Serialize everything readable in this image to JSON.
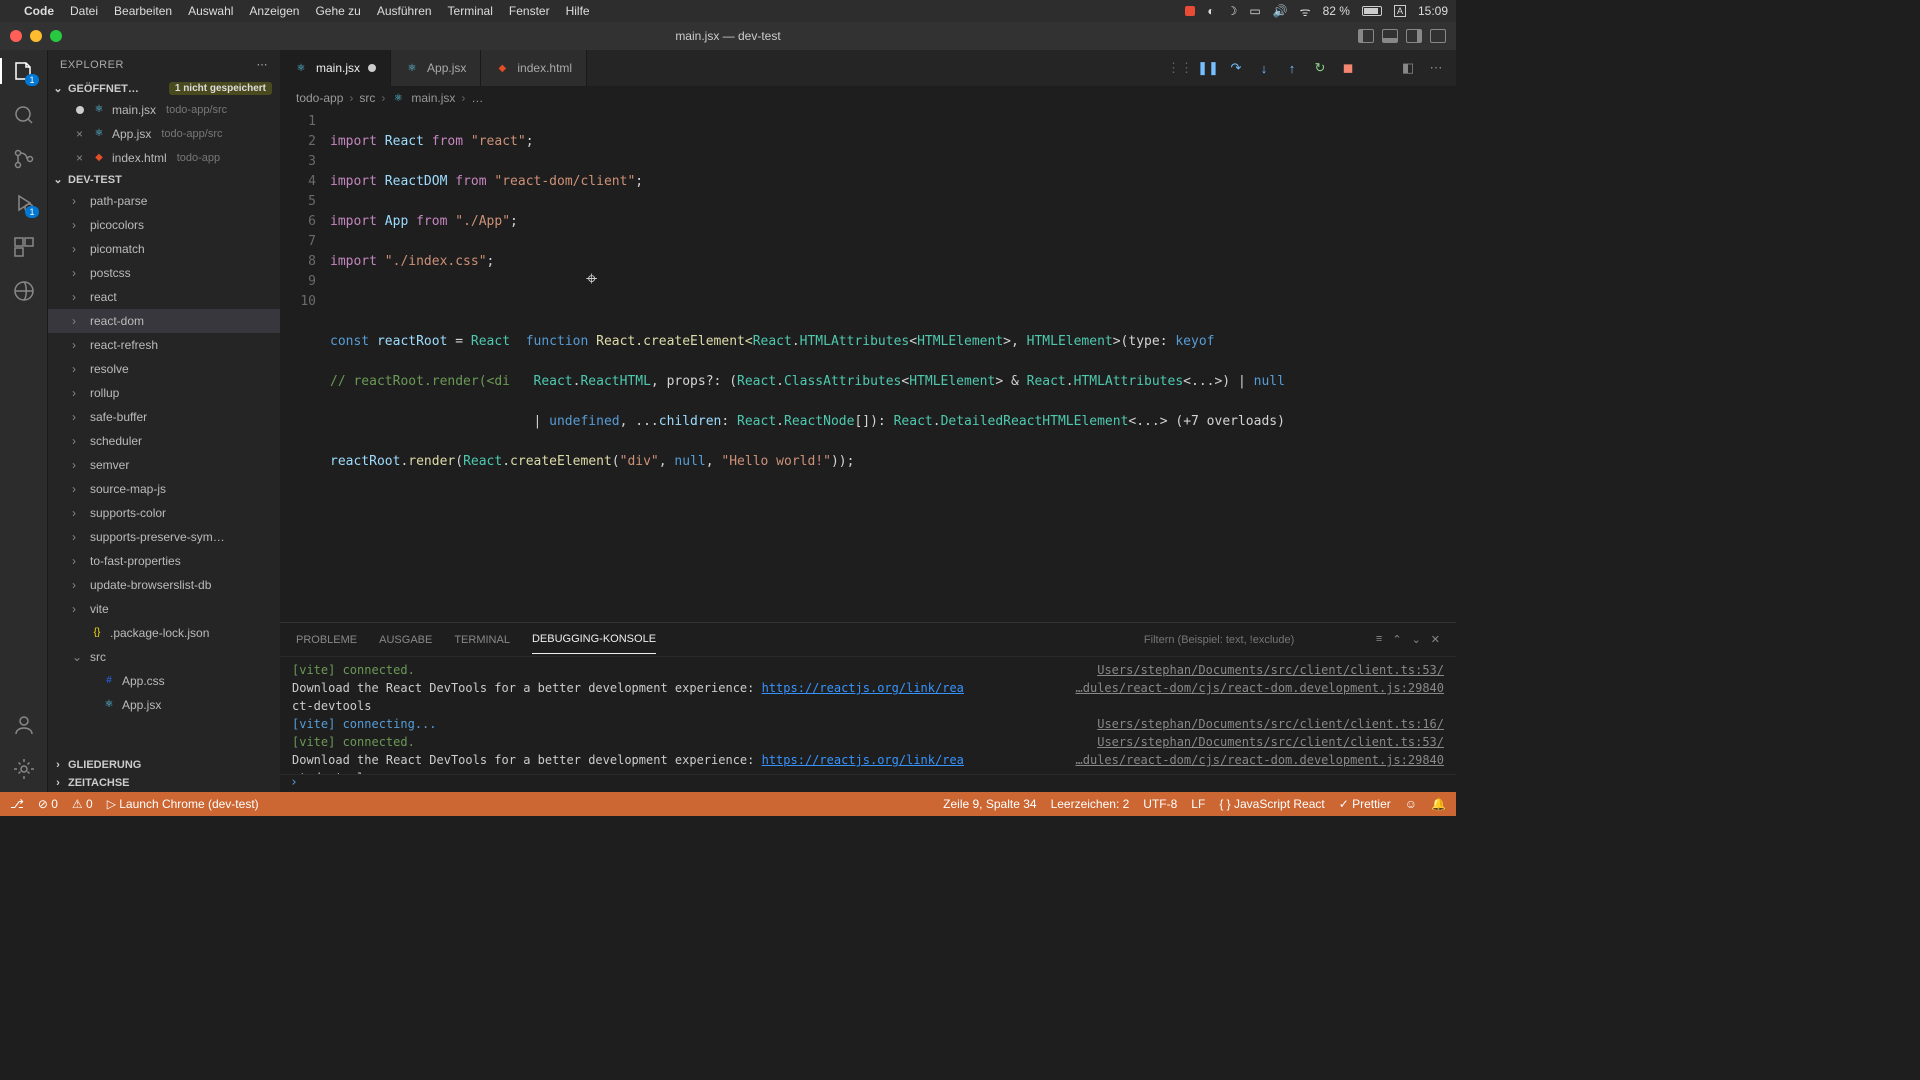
{
  "menubar": {
    "app": "Code",
    "items": [
      "Datei",
      "Bearbeiten",
      "Auswahl",
      "Anzeigen",
      "Gehe zu",
      "Ausführen",
      "Terminal",
      "Fenster",
      "Hilfe"
    ],
    "battery": "82 %",
    "time": "15:09"
  },
  "window": {
    "title": "main.jsx — dev-test"
  },
  "activity": {
    "explorer_badge": "1",
    "debug_badge": "1"
  },
  "sidebar": {
    "title": "EXPLORER",
    "open_editors": {
      "label": "GEÖFFNET…",
      "unsaved": "1 nicht gespeichert"
    },
    "open_files": [
      {
        "name": "main.jsx",
        "detail": "todo-app/src",
        "dirty": true,
        "sel": false
      },
      {
        "name": "App.jsx",
        "detail": "todo-app/src",
        "dirty": false,
        "sel": false
      },
      {
        "name": "index.html",
        "detail": "todo-app",
        "dirty": false,
        "sel": false
      }
    ],
    "workspace": "DEV-TEST",
    "tree": [
      {
        "name": "path-parse",
        "kind": "folder"
      },
      {
        "name": "picocolors",
        "kind": "folder"
      },
      {
        "name": "picomatch",
        "kind": "folder"
      },
      {
        "name": "postcss",
        "kind": "folder"
      },
      {
        "name": "react",
        "kind": "folder"
      },
      {
        "name": "react-dom",
        "kind": "folder",
        "sel": true
      },
      {
        "name": "react-refresh",
        "kind": "folder"
      },
      {
        "name": "resolve",
        "kind": "folder"
      },
      {
        "name": "rollup",
        "kind": "folder"
      },
      {
        "name": "safe-buffer",
        "kind": "folder"
      },
      {
        "name": "scheduler",
        "kind": "folder"
      },
      {
        "name": "semver",
        "kind": "folder"
      },
      {
        "name": "source-map-js",
        "kind": "folder"
      },
      {
        "name": "supports-color",
        "kind": "folder"
      },
      {
        "name": "supports-preserve-sym…",
        "kind": "folder"
      },
      {
        "name": "to-fast-properties",
        "kind": "folder"
      },
      {
        "name": "update-browserslist-db",
        "kind": "folder"
      },
      {
        "name": "vite",
        "kind": "folder"
      },
      {
        "name": ".package-lock.json",
        "kind": "json"
      },
      {
        "name": "src",
        "kind": "folder-open"
      },
      {
        "name": "App.css",
        "kind": "css",
        "sub": true
      },
      {
        "name": "App.jsx",
        "kind": "jsx",
        "sub": true
      }
    ],
    "outline": "GLIEDERUNG",
    "timeline": "ZEITACHSE"
  },
  "tabs": [
    {
      "name": "main.jsx",
      "icon": "jsx",
      "active": true,
      "dirty": true
    },
    {
      "name": "App.jsx",
      "icon": "jsx",
      "active": false,
      "dirty": false
    },
    {
      "name": "index.html",
      "icon": "html",
      "active": false,
      "dirty": false
    }
  ],
  "breadcrumbs": [
    "todo-app",
    "src",
    "main.jsx",
    "…"
  ],
  "line_numbers": [
    "1",
    "2",
    "3",
    "4",
    "5",
    "6",
    "7",
    "8",
    "9",
    "10"
  ],
  "signature_help": {
    "l1a": "function",
    "l1b": " React.createElement<",
    "l1c": "React",
    "l1d": ".",
    "l1e": "HTMLAttributes",
    "l1f": "<",
    "l1g": "HTMLElement",
    "l1h": ">, ",
    "l1i": "HTMLElement",
    "l1j": ">(type: ",
    "l1k": "keyof",
    "l2a": "React",
    "l2b": ".",
    "l2c": "ReactHTML",
    "l2d": ", props?: (",
    "l2e": "React",
    "l2f": ".",
    "l2g": "ClassAttributes",
    "l2h": "<",
    "l2i": "HTMLElement",
    "l2j": "> & ",
    "l2k": "React",
    "l2l": ".",
    "l2m": "HTMLAttributes",
    "l2n": "<...>) | ",
    "l2o": "null",
    "l3a": "| ",
    "l3b": "undefined",
    "l3c": ", ...",
    "l3d": "children",
    "l3e": ": ",
    "l3f": "React",
    "l3g": ".",
    "l3h": "ReactNode",
    "l3i": "[]): ",
    "l3j": "React",
    "l3k": ".",
    "l3l": "DetailedReactHTMLElement",
    "l3m": "<...> (+7 overloads)"
  },
  "code": {
    "l1": {
      "a": "import",
      "b": " React ",
      "c": "from",
      "d": " \"react\"",
      "e": ";"
    },
    "l2": {
      "a": "import",
      "b": " ReactDOM ",
      "c": "from",
      "d": " \"react-dom/client\"",
      "e": ";"
    },
    "l3": {
      "a": "import",
      "b": " App ",
      "c": "from",
      "d": " \"./App\"",
      "e": ";"
    },
    "l4": {
      "a": "import",
      "b": " \"./index.css\"",
      "c": ";"
    },
    "l6": {
      "a": "const",
      "b": " reactRoot ",
      "c": "=",
      "d": " React"
    },
    "l7": {
      "a": "// reactRoot.render(<di"
    },
    "l9": {
      "a": "reactRoot",
      "b": ".",
      "c": "render",
      "d": "(",
      "e": "React",
      "f": ".",
      "g": "createElement",
      "h": "(",
      "i": "\"div\"",
      "j": ", ",
      "k": "null",
      "l": ", ",
      "m": "\"Hello world!\"",
      "n": "));"
    }
  },
  "panel": {
    "tabs": [
      "PROBLEME",
      "AUSGABE",
      "TERMINAL",
      "DEBUGGING-KONSOLE"
    ],
    "tabs_active": 3,
    "filter_placeholder": "Filtern (Beispiel: text, !exclude)",
    "lines": [
      {
        "msg": "[vite] connected.",
        "cls": "c-green",
        "src": "Users/stephan/Documents/src/client/client.ts:53/"
      },
      {
        "msg": "Download the React DevTools for a better development experience: https://reactjs.org/link/rea",
        "src": "…dules/react-dom/cjs/react-dom.development.js:29840"
      },
      {
        "msg": "ct-devtools",
        "cont": true
      },
      {
        "msg": "[vite] connecting...",
        "cls": "c-blue",
        "src": "Users/stephan/Documents/src/client/client.ts:16/"
      },
      {
        "msg": "[vite] connected.",
        "cls": "c-green",
        "src": "Users/stephan/Documents/src/client/client.ts:53/"
      },
      {
        "msg": "Download the React DevTools for a better development experience: https://reactjs.org/link/rea",
        "src": "…dules/react-dom/cjs/react-dom.development.js:29840"
      },
      {
        "msg": "ct-devtools",
        "cont": true
      }
    ]
  },
  "status": {
    "errors": "0",
    "warnings": "0",
    "launch": "Launch Chrome (dev-test)",
    "pos": "Zeile 9, Spalte 34",
    "spaces": "Leerzeichen: 2",
    "enc": "UTF-8",
    "eol": "LF",
    "lang": "JavaScript React",
    "prettier": "Prettier"
  }
}
